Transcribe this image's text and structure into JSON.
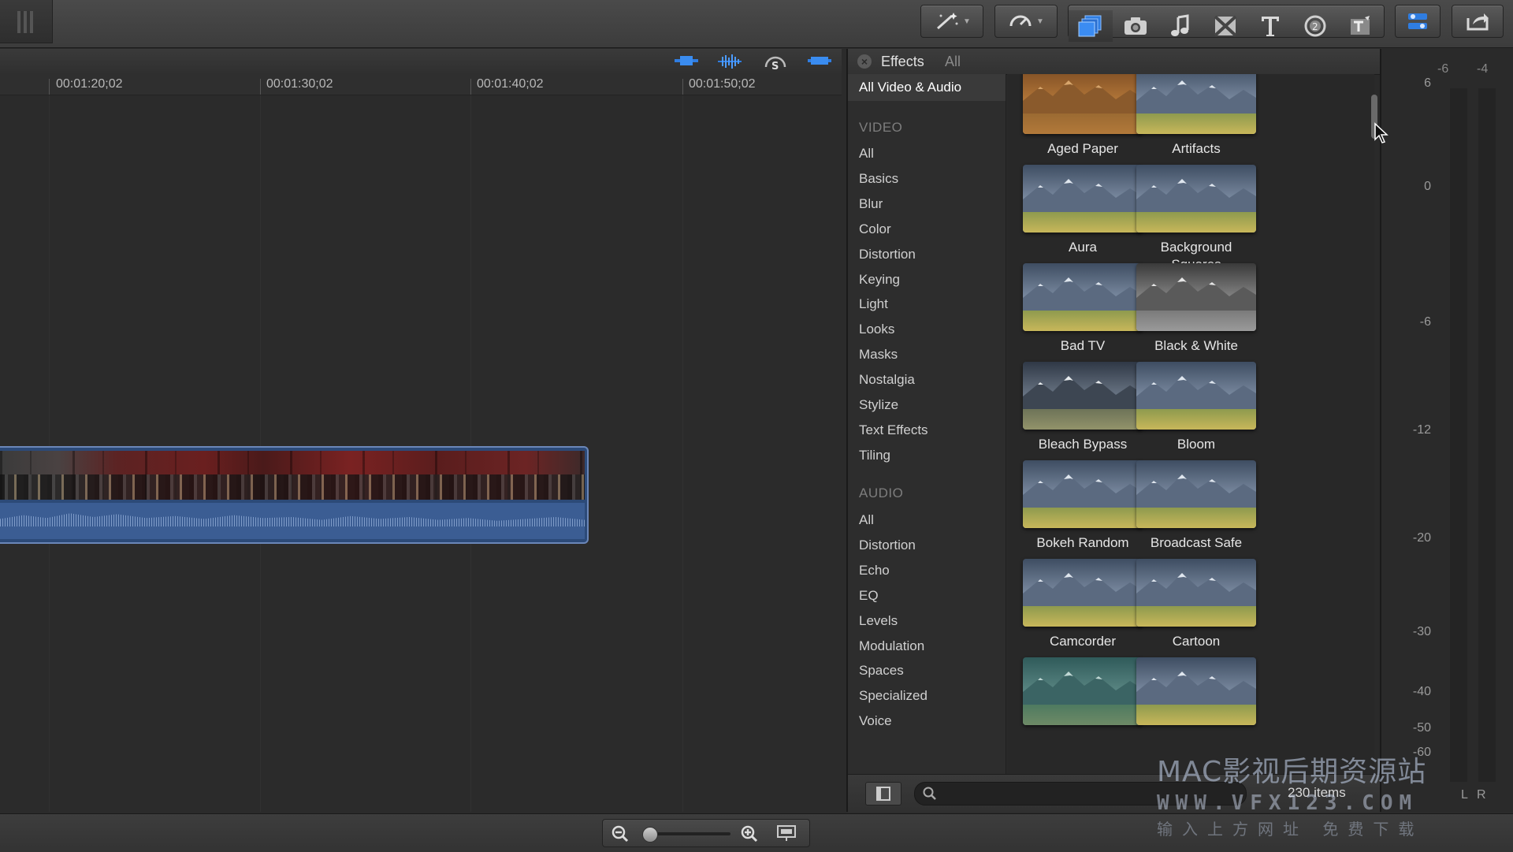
{
  "timeline": {
    "timecodes": [
      "00:01:20;02",
      "00:01:30;02",
      "00:01:40;02",
      "00:01:50;02"
    ]
  },
  "effects_browser": {
    "title": "Effects",
    "filter": "All",
    "sidebar": {
      "selected": "All Video & Audio",
      "video_header": "VIDEO",
      "video_items": [
        "All",
        "Basics",
        "Blur",
        "Color",
        "Distortion",
        "Keying",
        "Light",
        "Looks",
        "Masks",
        "Nostalgia",
        "Stylize",
        "Text Effects",
        "Tiling"
      ],
      "audio_header": "AUDIO",
      "audio_items": [
        "All",
        "Distortion",
        "Echo",
        "EQ",
        "Levels",
        "Modulation",
        "Spaces",
        "Specialized",
        "Voice"
      ]
    },
    "effects": [
      {
        "name": "Aged Paper",
        "style": "aged"
      },
      {
        "name": "Artifacts",
        "style": "normal"
      },
      {
        "name": "Aura",
        "style": "normal"
      },
      {
        "name": "Background Squares",
        "style": "normal"
      },
      {
        "name": "Bad TV",
        "style": "normal"
      },
      {
        "name": "Black & White",
        "style": "bw"
      },
      {
        "name": "Bleach Bypass",
        "style": "bleach"
      },
      {
        "name": "Bloom",
        "style": "normal"
      },
      {
        "name": "Bokeh Random",
        "style": "normal"
      },
      {
        "name": "Broadcast Safe",
        "style": "normal"
      },
      {
        "name": "Camcorder",
        "style": "normal"
      },
      {
        "name": "Cartoon",
        "style": "normal"
      },
      {
        "name": "",
        "style": "teal"
      },
      {
        "name": "",
        "style": "normal"
      }
    ],
    "item_count": "230 items"
  },
  "audio_meter": {
    "top_labels": [
      "-6",
      "-4"
    ],
    "scale": [
      "6",
      "0",
      "-6",
      "-12",
      "-20",
      "-30",
      "-40",
      "-50",
      "-60"
    ],
    "channels": [
      "L",
      "R"
    ]
  },
  "watermark": {
    "line1": "MAC影视后期资源站",
    "line2": "WWW.VFX123.COM",
    "line3": "输入上方网址 免费下载"
  }
}
